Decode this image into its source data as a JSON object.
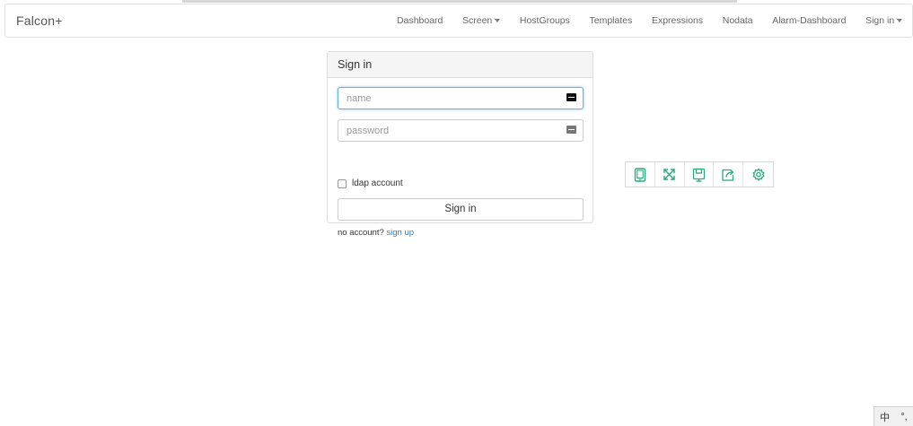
{
  "app": {
    "brand": "Falcon+"
  },
  "nav": {
    "items": [
      {
        "label": "Dashboard",
        "dropdown": false
      },
      {
        "label": "Screen",
        "dropdown": true
      },
      {
        "label": "HostGroups",
        "dropdown": false
      },
      {
        "label": "Templates",
        "dropdown": false
      },
      {
        "label": "Expressions",
        "dropdown": false
      },
      {
        "label": "Nodata",
        "dropdown": false
      },
      {
        "label": "Alarm-Dashboard",
        "dropdown": false
      },
      {
        "label": "Sign in",
        "dropdown": true
      }
    ]
  },
  "login": {
    "title": "Sign in",
    "name_placeholder": "name",
    "name_value": "",
    "password_placeholder": "password",
    "password_value": "",
    "ldap_label": "ldap account",
    "ldap_checked": false,
    "submit_label": "Sign in",
    "no_account_text": "no account?",
    "signup_link": "sign up"
  },
  "toolbar": {
    "icons": [
      "tablet-icon",
      "expand-icon",
      "save-icon",
      "share-icon",
      "settings-gear-icon"
    ],
    "accent_color": "#2ca87f"
  },
  "ime": {
    "lang": "中",
    "punct": "°,"
  },
  "colors": {
    "link": "#337ab7",
    "focus_border": "#66afe9",
    "panel_heading_bg": "#f5f5f5"
  }
}
